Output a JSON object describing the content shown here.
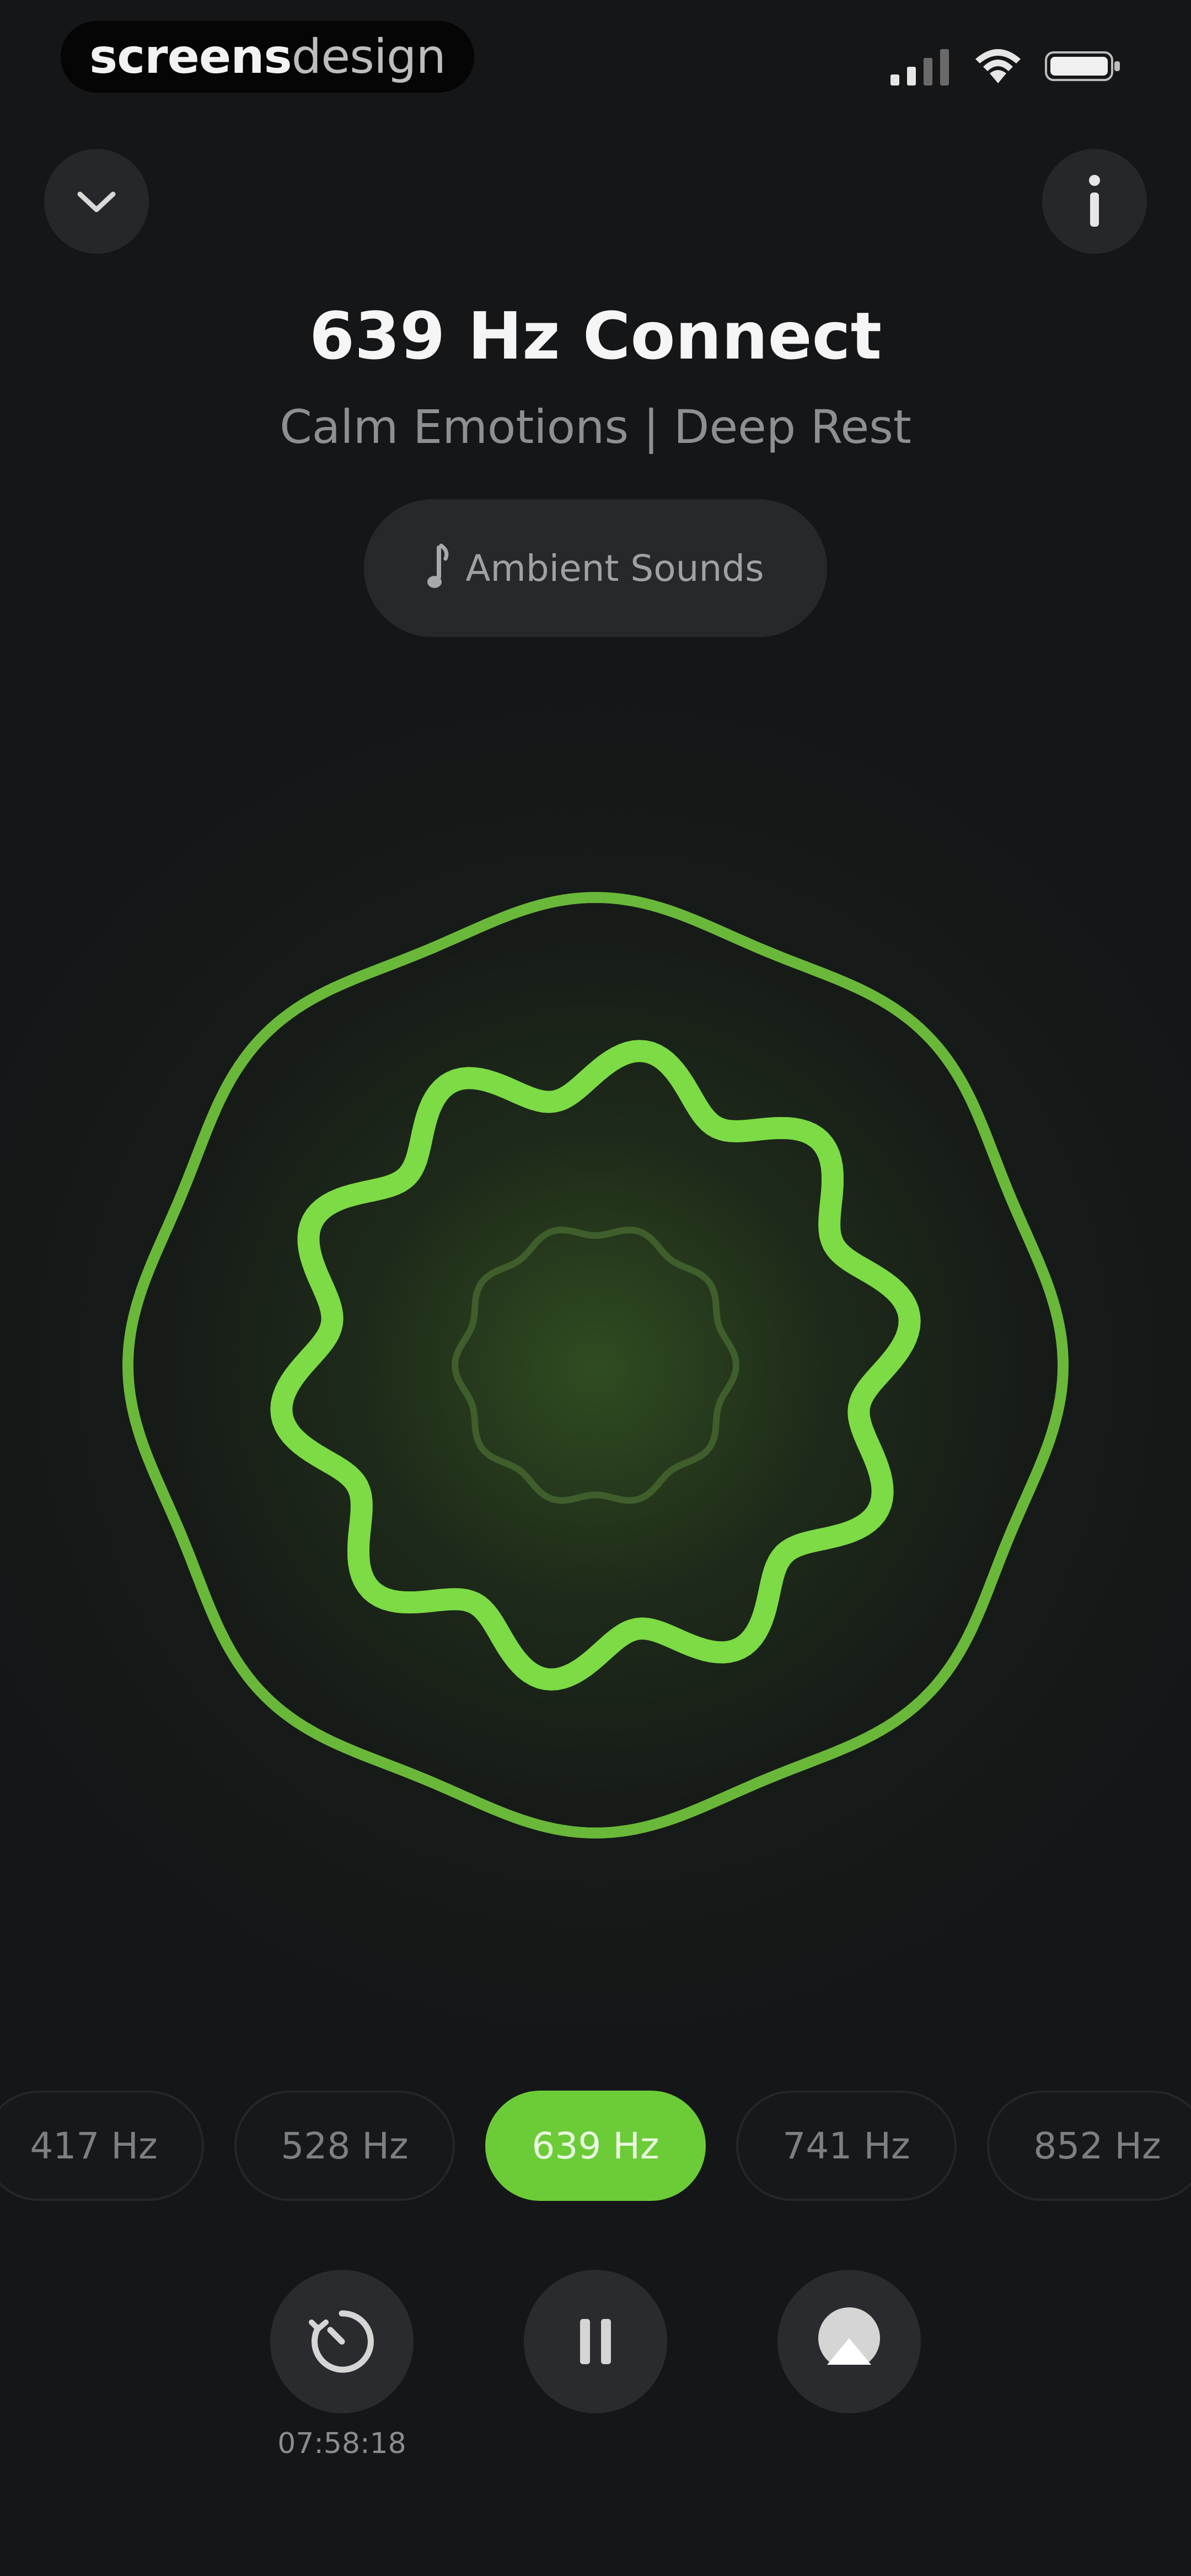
{
  "status_bar": {
    "brand_strong": "screens",
    "brand_light": "design"
  },
  "header": {
    "collapse_icon": "chevron-down-icon",
    "info_icon": "info-icon"
  },
  "track": {
    "title": "639 Hz Connect",
    "subtitle": "Calm Emotions | Deep Rest",
    "ambient_label": "Ambient Sounds"
  },
  "frequencies": [
    {
      "label": "417 Hz",
      "active": false
    },
    {
      "label": "528 Hz",
      "active": false
    },
    {
      "label": "639 Hz",
      "active": true
    },
    {
      "label": "741 Hz",
      "active": false
    },
    {
      "label": "852 Hz",
      "active": false
    }
  ],
  "controls": {
    "timer_icon": "timer-icon",
    "pause_icon": "pause-icon",
    "cast_icon": "airplay-icon",
    "timer_value": "07:58:18"
  },
  "colors": {
    "accent": "#6ccc38",
    "background": "#151618"
  }
}
